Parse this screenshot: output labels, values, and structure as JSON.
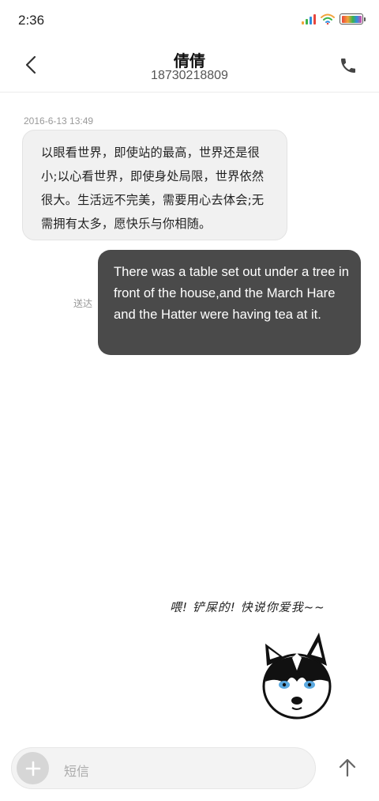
{
  "status_bar": {
    "time": "2:36",
    "signal_colors": [
      "#f2a33a",
      "#3bb34a",
      "#2c8fe0",
      "#e8453c"
    ],
    "wifi_color": "#f2a33a",
    "battery_color": "#d64aa6"
  },
  "header": {
    "contact_name": "倩倩",
    "phone_number": "18730218809",
    "back_icon": "chevron-left-icon",
    "call_icon": "phone-icon"
  },
  "conversation": {
    "timestamp": "2016-6-13 13:49",
    "incoming_message": "以眼看世界，即使站的最高，世界还是很小;以心看世界，即使身处局限，世界依然很大。生活远不完美，需要用心去体会;无需拥有太多，愿快乐与你相随。",
    "outgoing_message": "There was a table set out under a tree in front of the house,and the March Hare and the Hatter were having tea at it.",
    "outgoing_status": "送达",
    "sticker_caption": "喂! 铲屎的! 快说你爱我~~"
  },
  "composer": {
    "placeholder": "短信",
    "add_icon": "plus-icon",
    "send_icon": "arrow-up-icon"
  },
  "colors": {
    "outgoing_bubble": "#4a4a4a",
    "incoming_bubble": "#f1f1f1"
  }
}
